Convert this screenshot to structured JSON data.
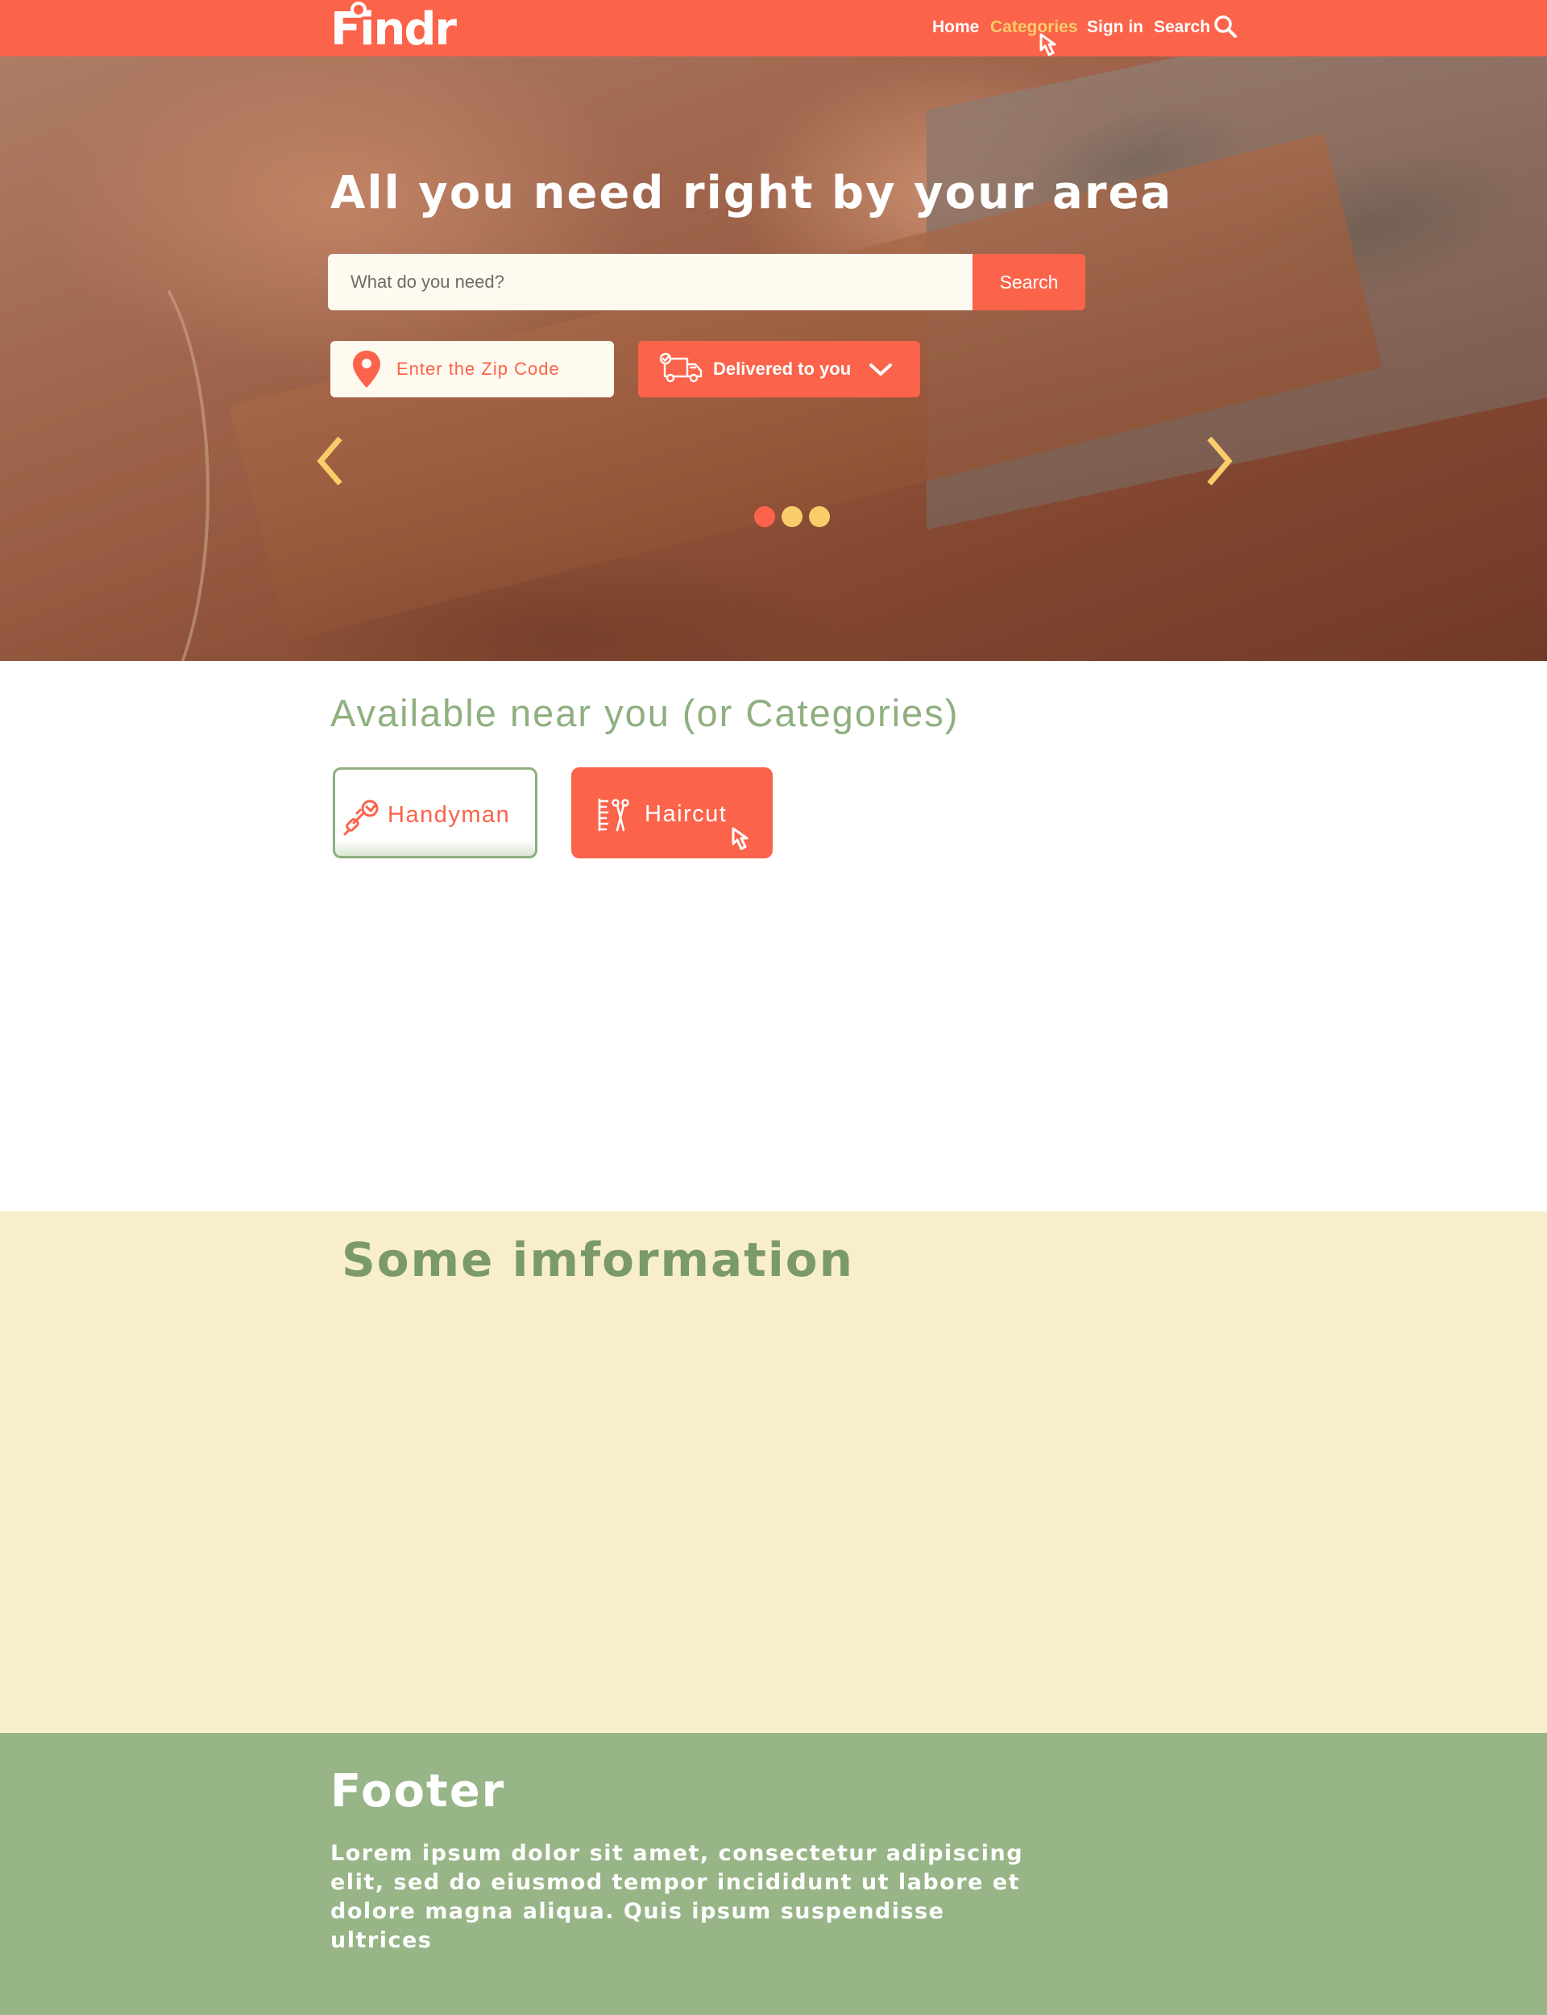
{
  "nav": {
    "logo": "Findr",
    "links": [
      "Home",
      "Categories",
      "Sign in",
      "Search"
    ],
    "active_link": "Categories",
    "search_icon": "magnifier-icon"
  },
  "hero": {
    "title": "All you need right by your area",
    "search_placeholder": "What do you need?",
    "search_button": "Search",
    "zip_label": "Enter the Zip Code",
    "zip_icon": "map-pin-icon",
    "delivery_label": "Delivered to you",
    "delivery_icon": "truck-icon",
    "carousel": {
      "slides": 3,
      "active_slide": 1
    }
  },
  "categories": {
    "heading": "Available near you (or Categories)",
    "items": [
      {
        "label": "Handyman",
        "icon": "plug-wrench-icon"
      },
      {
        "label": "Haircut",
        "icon": "comb-scissors-icon"
      }
    ]
  },
  "info": {
    "heading": "Some imformation"
  },
  "footer": {
    "heading": "Footer",
    "text": "Lorem ipsum dolor sit amet, consectetur adipiscing elit, sed do eiusmod tempor incididunt ut labore et dolore magna aliqua. Quis ipsum suspendisse ultrices"
  },
  "colors": {
    "primary": "#fb634a",
    "accent": "#f9cd6a",
    "green": "#8faf7f",
    "cream": "#f8eecc",
    "footer_green": "#97b586"
  }
}
